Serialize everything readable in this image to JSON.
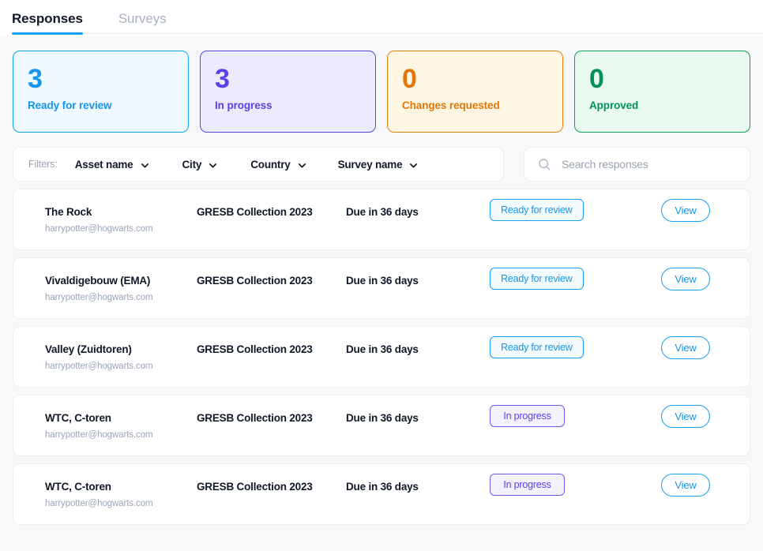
{
  "tabs": [
    {
      "label": "Responses",
      "active": true
    },
    {
      "label": "Surveys",
      "active": false
    }
  ],
  "stats": [
    {
      "count": "3",
      "label": "Ready for review",
      "theme": "blue",
      "color": "#1195ef"
    },
    {
      "count": "3",
      "label": "In progress",
      "theme": "purple",
      "color": "#5a40e8"
    },
    {
      "count": "0",
      "label": "Changes requested",
      "theme": "orange",
      "color": "#e2760a"
    },
    {
      "count": "0",
      "label": "Approved",
      "theme": "green",
      "color": "#009256"
    }
  ],
  "filters": {
    "label": "Filters:",
    "chips": [
      {
        "label": "Asset name"
      },
      {
        "label": "City"
      },
      {
        "label": "Country"
      },
      {
        "label": "Survey name"
      }
    ]
  },
  "search": {
    "placeholder": "Search responses",
    "value": ""
  },
  "rows": [
    {
      "name": "The Rock",
      "email": "harrypotter@hogwarts.com",
      "survey": "GRESB Collection 2023",
      "due": "Due in 36 days",
      "status": "Ready for review",
      "status_theme": "ready",
      "action": "View"
    },
    {
      "name": "Vivaldigebouw (EMA)",
      "email": "harrypotter@hogwarts.com",
      "survey": "GRESB Collection 2023",
      "due": "Due in 36 days",
      "status": "Ready for review",
      "status_theme": "ready",
      "action": "View"
    },
    {
      "name": "Valley (Zuidtoren)",
      "email": "harrypotter@hogwarts.com",
      "survey": "GRESB Collection 2023",
      "due": "Due in 36 days",
      "status": "Ready for review",
      "status_theme": "ready",
      "action": "View"
    },
    {
      "name": "WTC, C-toren",
      "email": "harrypotter@hogwarts.com",
      "survey": "GRESB Collection 2023",
      "due": "Due in 36 days",
      "status": "In progress",
      "status_theme": "progress",
      "action": "View"
    },
    {
      "name": "WTC, C-toren",
      "email": "harrypotter@hogwarts.com",
      "survey": "GRESB Collection 2023",
      "due": "Due in 36 days",
      "status": "In progress",
      "status_theme": "progress",
      "action": "View"
    }
  ],
  "icons": {
    "chevron": "chevron-down-icon",
    "search": "search-icon"
  }
}
